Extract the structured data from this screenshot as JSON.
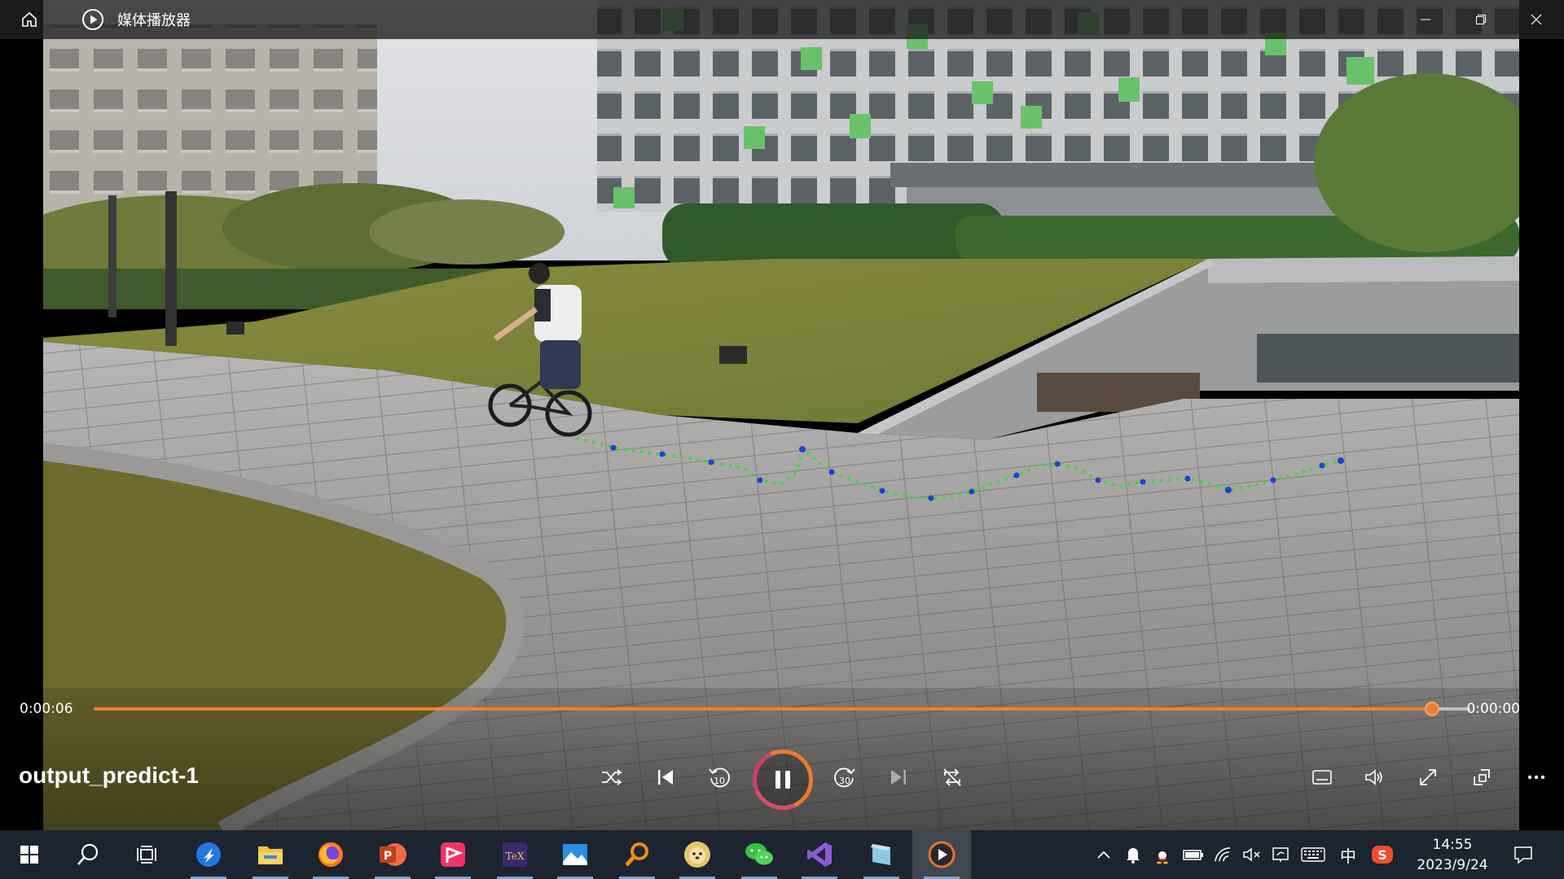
{
  "window": {
    "title": "媒体播放器",
    "home_icon": "home-icon",
    "app_icon": "media-player-icon",
    "controls": [
      "minimize-icon",
      "restore-icon",
      "close-icon"
    ]
  },
  "player": {
    "current_time": "0:00:06",
    "total_time": "0:00:00",
    "progress": 0.972,
    "video_title": "output_predict-1",
    "accent": "#ef8030",
    "left_controls": [
      {
        "name": "shuffle-button",
        "icon": "shuffle-icon"
      },
      {
        "name": "previous-button",
        "icon": "skip-previous-icon"
      },
      {
        "name": "rewind-10-button",
        "icon": "rewind-10-icon",
        "label": "10"
      },
      {
        "name": "pause-button",
        "icon": "pause-icon"
      },
      {
        "name": "forward-30-button",
        "icon": "forward-30-icon",
        "label": "30"
      },
      {
        "name": "next-button",
        "icon": "skip-next-icon"
      },
      {
        "name": "repeat-button",
        "icon": "repeat-off-icon"
      }
    ],
    "right_controls": [
      {
        "name": "subtitles-button",
        "icon": "subtitles-icon"
      },
      {
        "name": "volume-button",
        "icon": "volume-icon"
      },
      {
        "name": "fullscreen-button",
        "icon": "fullscreen-icon"
      },
      {
        "name": "mini-player-button",
        "icon": "mini-player-icon"
      },
      {
        "name": "more-options-button",
        "icon": "more-icon"
      }
    ]
  },
  "taskbar": {
    "apps": [
      {
        "name": "start",
        "icon": "windows-icon"
      },
      {
        "name": "search",
        "icon": "search-icon"
      },
      {
        "name": "task-view",
        "icon": "task-view-icon"
      },
      {
        "name": "feishu",
        "icon": "feishu-icon",
        "running": true
      },
      {
        "name": "file-explorer",
        "icon": "folder-icon",
        "running": true
      },
      {
        "name": "firefox",
        "icon": "firefox-icon",
        "running": true
      },
      {
        "name": "powerpoint",
        "icon": "powerpoint-icon",
        "running": true
      },
      {
        "name": "flag-app",
        "icon": "flag-app-icon",
        "running": true
      },
      {
        "name": "texstudio",
        "icon": "tex-icon",
        "running": true
      },
      {
        "name": "photos",
        "icon": "photos-icon",
        "running": true
      },
      {
        "name": "search-tool",
        "icon": "magnifier-icon",
        "running": true
      },
      {
        "name": "dog-app",
        "icon": "dog-app-icon",
        "running": true
      },
      {
        "name": "wechat",
        "icon": "wechat-icon",
        "running": true
      },
      {
        "name": "visual-studio",
        "icon": "visual-studio-icon",
        "running": true
      },
      {
        "name": "notes-app",
        "icon": "notes-icon",
        "running": true
      },
      {
        "name": "media-player",
        "icon": "media-player-icon",
        "running": true,
        "active": true
      }
    ],
    "tray": [
      "chevron-up-icon",
      "notification-bell-icon",
      "qq-icon",
      "battery-icon",
      "wifi-icon",
      "volume-mute-icon",
      "network-icon",
      "keyboard-icon",
      "ime-icon",
      "sogou-icon"
    ],
    "ime_label": "中",
    "time": "14:55",
    "date": "2023/9/24",
    "notification_icon": "action-center-icon"
  }
}
